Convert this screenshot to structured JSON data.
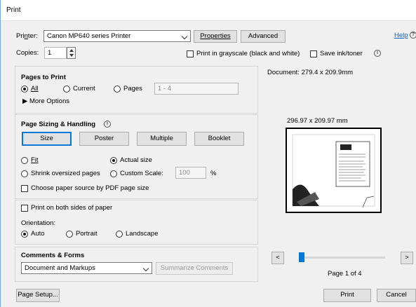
{
  "window": {
    "title": "Print"
  },
  "printer": {
    "label_prefix": "Pri",
    "label_underline": "n",
    "label_suffix": "ter:",
    "selected": "Canon MP640 series Printer",
    "properties_label": "Properties",
    "advanced_label": "Advanced",
    "help_label": "Help"
  },
  "copies": {
    "label": "Copies:",
    "value": "1"
  },
  "options": {
    "grayscale_label": "Print in grayscale (black and white)",
    "save_ink_label": "Save ink/toner"
  },
  "pages_to_print": {
    "title": "Pages to Print",
    "all_label": "All",
    "current_label": "Current",
    "pages_label": "Pages",
    "pages_value": "1 - 4",
    "more_options_label": "More Options",
    "selected": "All"
  },
  "sizing": {
    "title": "Page Sizing & Handling",
    "tabs": [
      "Size",
      "Poster",
      "Multiple",
      "Booklet"
    ],
    "active_tab": "Size",
    "fit_label": "Fit",
    "actual_size_label": "Actual size",
    "shrink_label": "Shrink oversized pages",
    "custom_scale_label": "Custom Scale:",
    "custom_scale_value": "100",
    "percent": "%",
    "paper_source_label": "Choose paper source by PDF page size",
    "selected": "Actual size"
  },
  "duplex": {
    "label": "Print on both sides of paper"
  },
  "orientation": {
    "title": "Orientation:",
    "auto_label": "Auto",
    "portrait_label": "Portrait",
    "landscape_label": "Landscape",
    "selected": "Auto"
  },
  "comments": {
    "title": "Comments & Forms",
    "selected": "Document and Markups",
    "summarize_label": "Summarize Comments"
  },
  "preview": {
    "document_size": "Document: 279.4 x 209.9mm",
    "page_size": "296.97 x 209.97 mm",
    "page_indicator": "Page 1 of 4",
    "prev_label": "<",
    "next_label": ">",
    "slider_fraction": 0.0
  },
  "footer": {
    "page_setup_label": "Page Setup...",
    "print_label": "Print",
    "cancel_label": "Cancel"
  },
  "colors": {
    "accent": "#0078d7",
    "window_border": "#7aa7d6"
  }
}
